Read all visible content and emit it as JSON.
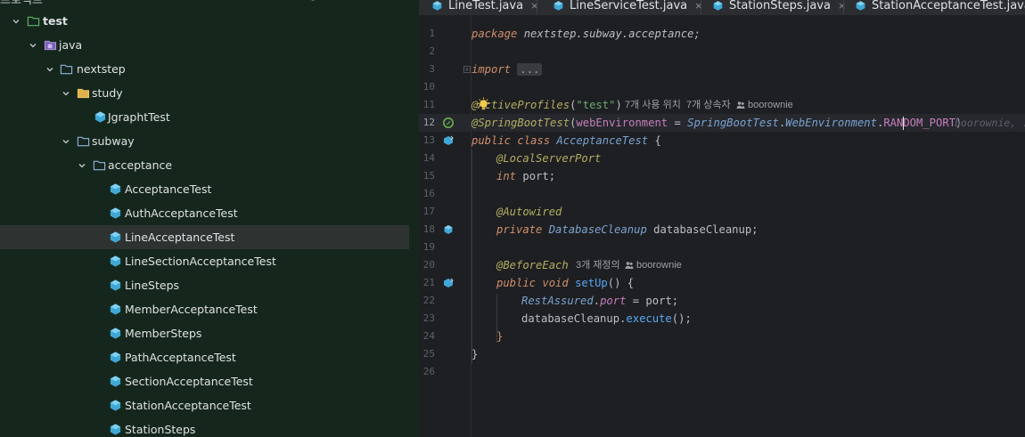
{
  "tree": {
    "header": {
      "title": "프로젝트"
    },
    "items": [
      {
        "label": "test",
        "bold": true,
        "icon": "test-folder-icon"
      },
      {
        "label": "java",
        "bold": false,
        "icon": "java-source-folder-icon"
      },
      {
        "label": "nextstep",
        "bold": false,
        "icon": "package-folder-icon"
      },
      {
        "label": "study",
        "bold": false,
        "icon": "folder-icon"
      },
      {
        "label": "JgraphtTest",
        "bold": false,
        "icon": "test-class-icon"
      },
      {
        "label": "subway",
        "bold": false,
        "icon": "package-folder-icon"
      },
      {
        "label": "acceptance",
        "bold": false,
        "icon": "package-folder-icon"
      },
      {
        "label": "AcceptanceTest",
        "bold": false,
        "icon": "test-class-icon"
      },
      {
        "label": "AuthAcceptanceTest",
        "bold": false,
        "icon": "test-class-icon"
      },
      {
        "label": "LineAcceptanceTest",
        "bold": false,
        "icon": "test-class-icon",
        "selected": true
      },
      {
        "label": "LineSectionAcceptanceTest",
        "bold": false,
        "icon": "test-class-icon"
      },
      {
        "label": "LineSteps",
        "bold": false,
        "icon": "test-class-icon"
      },
      {
        "label": "MemberAcceptanceTest",
        "bold": false,
        "icon": "test-class-icon"
      },
      {
        "label": "MemberSteps",
        "bold": false,
        "icon": "test-class-icon"
      },
      {
        "label": "PathAcceptanceTest",
        "bold": false,
        "icon": "test-class-icon"
      },
      {
        "label": "SectionAcceptanceTest",
        "bold": false,
        "icon": "test-class-icon"
      },
      {
        "label": "StationAcceptanceTest",
        "bold": false,
        "icon": "test-class-icon"
      },
      {
        "label": "StationSteps",
        "bold": false,
        "icon": "test-class-icon"
      }
    ]
  },
  "tabs": [
    {
      "label": "LineTest.java",
      "close": "×"
    },
    {
      "label": "LineServiceTest.java",
      "close": "×"
    },
    {
      "label": "StationSteps.java",
      "close": "×"
    },
    {
      "label": "StationAcceptanceTest.java",
      "close": ""
    }
  ],
  "editor": {
    "line_numbers": [
      "1",
      "2",
      "3",
      "10",
      "11",
      "12",
      "13",
      "14",
      "15",
      "16",
      "17",
      "18",
      "19",
      "20",
      "21",
      "22",
      "23",
      "24",
      "25",
      "26"
    ],
    "current_line": "12",
    "code": {
      "package_kw": "package",
      "package_name": "nextstep.subway.acceptance;",
      "import_kw": "import",
      "import_fold": "...",
      "active_profiles": "@ActiveProfiles",
      "active_profiles_arg": "\"test\"",
      "spring_boot_test": "@SpringBootTest",
      "sbt_param": "webEnvironment",
      "sbt_eq": " = ",
      "sbt_class": "SpringBootTest",
      "sbt_dot1": ".",
      "sbt_env": "WebEnvironment",
      "sbt_dot2": ".",
      "sbt_field_a": "RAN",
      "sbt_field_b": "DOM_PORT",
      "public_kw": "public",
      "class_kw": "class",
      "class_name": "AcceptanceTest",
      "open_brace": "{",
      "local_server_port": "@LocalServerPort",
      "int_kw": "int",
      "port_field": "port;",
      "autowired": "@Autowired",
      "private_kw": "private",
      "cleanup_type": "DatabaseCleanup",
      "cleanup_field": "databaseCleanup;",
      "before_each": "@BeforeEach",
      "void_kw": "void",
      "setup_fn": "setUp",
      "setup_tail": "() {",
      "rest_assured": "RestAssured",
      "rest_port": "port",
      "rest_rhs": " = port;",
      "cleanup_call": "databaseCleanup.",
      "execute_fn": "execute",
      "execute_tail": "();",
      "close_brace": "}"
    },
    "hints": {
      "usages": "7개 사용 위치",
      "inheritors": "7개 상속자",
      "author": "boorownie",
      "modifications": "3개 재정의",
      "blame": "boorownie, ..."
    }
  }
}
